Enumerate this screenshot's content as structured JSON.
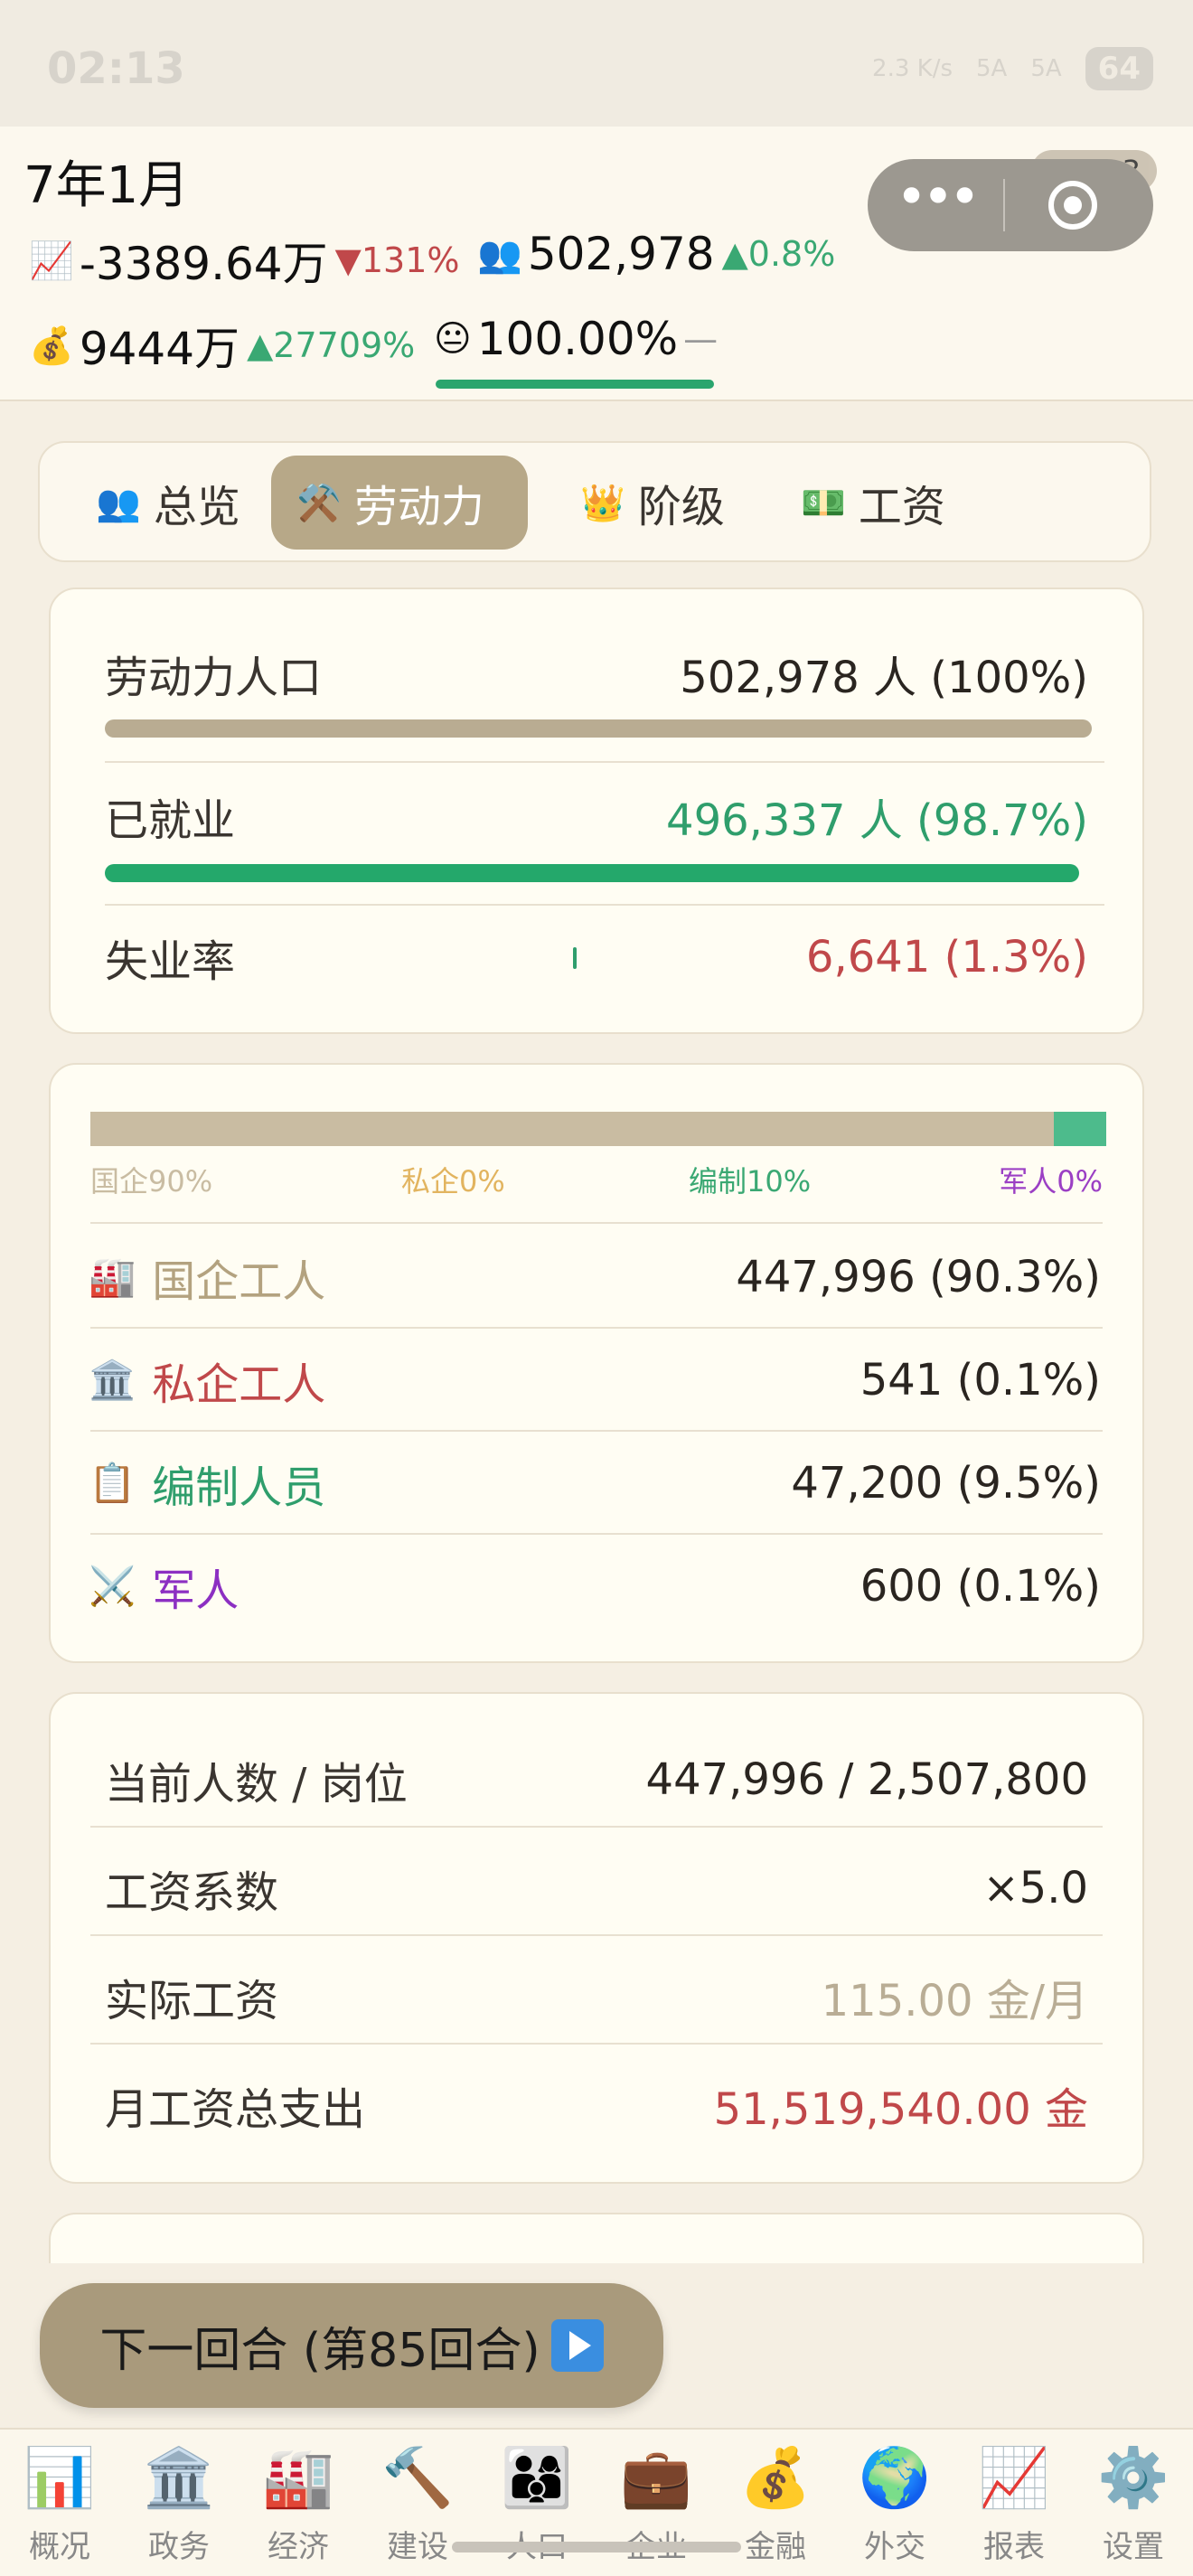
{
  "status_bar": {
    "time": "02:13",
    "net": "2.3 K/s",
    "sig1": "5A",
    "sig2": "5A",
    "battery": "64"
  },
  "header": {
    "date": "7年1月",
    "version": "V3.0.3",
    "gdp": {
      "icon": "📈",
      "value": "-3389.64万",
      "delta": "▼131%"
    },
    "population": {
      "icon": "👥",
      "value": "502,978",
      "delta": "▲0.8%"
    },
    "treasury": {
      "icon": "💰",
      "value": "9444万",
      "delta": "▲27709%"
    },
    "happiness": {
      "icon": "😐",
      "value": "100.00%",
      "delta": "—",
      "level": 1.0
    }
  },
  "tabs": [
    {
      "icon": "👥",
      "label": "总览"
    },
    {
      "icon": "⚒️",
      "label": "劳动力"
    },
    {
      "icon": "👑",
      "label": "阶级"
    },
    {
      "icon": "💵",
      "label": "工资"
    }
  ],
  "labor": {
    "total_label": "劳动力人口",
    "total_value": "502,978 人 (100%)",
    "total_level": 1.0,
    "employed_label": "已就业",
    "employed_value": "496,337 人 (98.7%)",
    "employed_level": 0.987,
    "unemp_label": "失业率",
    "unemp_value": "6,641 (1.3%)",
    "unemp_level": 0.013
  },
  "distribution": {
    "state_share": 0.9,
    "legend": [
      {
        "label": "国企90%",
        "color": "#c9bca2"
      },
      {
        "label": "私企0%",
        "color": "#e2b45f"
      },
      {
        "label": "编制10%",
        "color": "#3aa873"
      },
      {
        "label": "军人0%",
        "color": "#9b3fc4"
      }
    ],
    "rows": [
      {
        "icon": "🏭",
        "name": "国企工人",
        "value": "447,996 (90.3%)",
        "color": "#b3a27f"
      },
      {
        "icon": "🏛️",
        "name": "私企工人",
        "value": "541 (0.1%)",
        "color": "#c0484a"
      },
      {
        "icon": "📋",
        "name": "编制人员",
        "value": "47,200 (9.5%)",
        "color": "#2f9e6c"
      },
      {
        "icon": "⚔️",
        "name": "军人",
        "value": "600 (0.1%)",
        "color": "#8c2fc2"
      }
    ]
  },
  "wages": {
    "rows": [
      {
        "label": "当前人数 / 岗位",
        "value": "447,996 / 2,507,800",
        "color": "#2a2520"
      },
      {
        "label": "工资系数",
        "value": "×5.0",
        "color": "#2a2520"
      },
      {
        "label": "实际工资",
        "value": "115.00 金/月",
        "color": "#b9ad95"
      },
      {
        "label": "月工资总支出",
        "value": "51,519,540.00 金",
        "color": "#c0484a"
      }
    ]
  },
  "next_turn": {
    "label": "下一回合 (第85回合)"
  },
  "nav": [
    {
      "icon": "📊",
      "label": "概况"
    },
    {
      "icon": "🏛️",
      "label": "政务"
    },
    {
      "icon": "🏭",
      "label": "经济"
    },
    {
      "icon": "🔨",
      "label": "建设"
    },
    {
      "icon": "👨‍👩‍👦",
      "label": "人口"
    },
    {
      "icon": "💼",
      "label": "企业"
    },
    {
      "icon": "💰",
      "label": "金融"
    },
    {
      "icon": "🌍",
      "label": "外交"
    },
    {
      "icon": "📈",
      "label": "报表"
    },
    {
      "icon": "⚙️",
      "label": "设置"
    }
  ]
}
